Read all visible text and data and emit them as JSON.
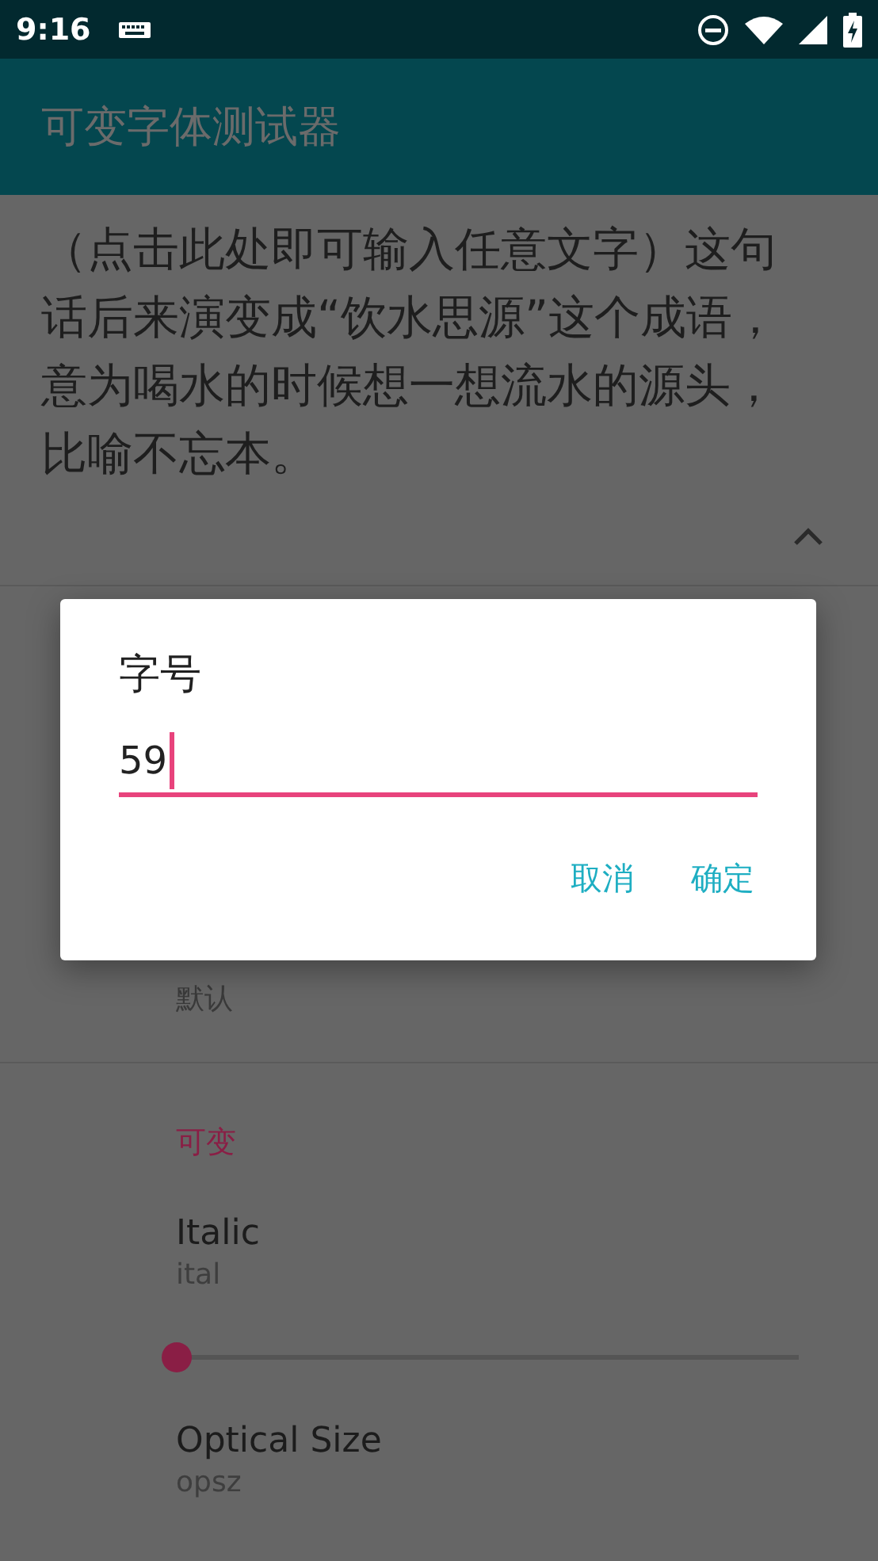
{
  "status_bar": {
    "time": "9:16"
  },
  "app_bar": {
    "title": "可变字体测试器"
  },
  "sample": {
    "text": "（点击此处即可输入任意文字）这句话后来演变成“饮水思源”这个成语，意为喝水的时候想一想流水的源头，比喻不忘本。",
    "expanded": true
  },
  "sections": [
    {
      "items": [
        {
          "kind": "text",
          "subtitle": "默认"
        }
      ]
    },
    {
      "header": "可变",
      "items": [
        {
          "kind": "slider",
          "title": "Italic",
          "subtitle": "ital",
          "level": 0
        },
        {
          "kind": "text",
          "title": "Optical Size",
          "subtitle": "opsz"
        }
      ]
    }
  ],
  "dialog": {
    "title": "字号",
    "input": {
      "value": "59",
      "focused": true
    },
    "buttons": [
      "取消",
      "确定"
    ]
  }
}
